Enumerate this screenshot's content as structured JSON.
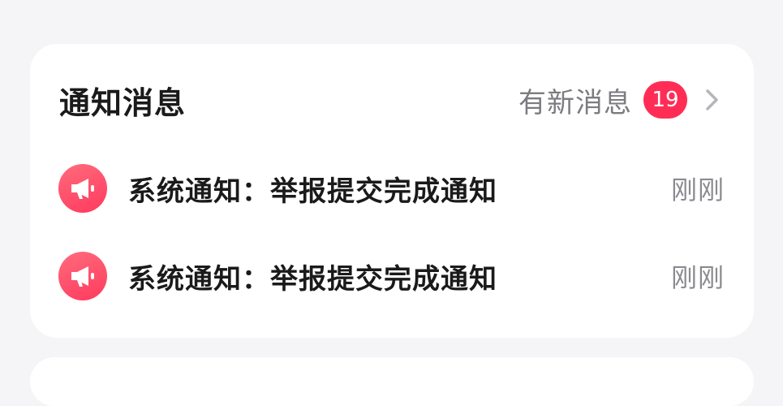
{
  "notifications": {
    "title": "通知消息",
    "new_label": "有新消息",
    "badge_count": "19",
    "items": [
      {
        "text": "系统通知：举报提交完成通知",
        "time": "刚刚",
        "icon": "megaphone-icon"
      },
      {
        "text": "系统通知：举报提交完成通知",
        "time": "刚刚",
        "icon": "megaphone-icon"
      }
    ]
  },
  "colors": {
    "badge": "#ff2d55",
    "icon_bg": "#ff4a66",
    "page_bg": "#f5f5f7"
  }
}
